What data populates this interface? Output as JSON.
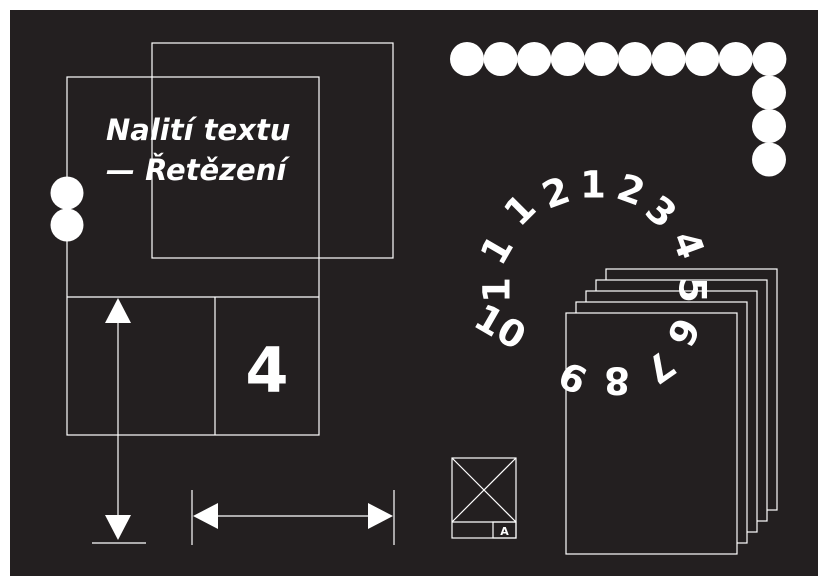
{
  "colors": {
    "background": "#231f20",
    "ink": "#ffffff"
  },
  "title": {
    "line1": "Nalití textu",
    "line2": "— Řetězení"
  },
  "frame": {
    "number": "4"
  },
  "page_stack": {
    "count": 5
  },
  "chain": {
    "horizontal_dots": 10,
    "vertical_dots": 3,
    "left_dots": 2
  },
  "counting_arc": {
    "labels": [
      "10",
      "1",
      "1",
      "1",
      "2",
      "1",
      "2",
      "3",
      "4",
      "5",
      "6",
      "7",
      "8",
      "9"
    ]
  },
  "placeholder_box": {
    "label": "A"
  },
  "icons": [
    "up-down-arrow-icon",
    "left-right-arrow-icon",
    "image-placeholder-icon"
  ]
}
